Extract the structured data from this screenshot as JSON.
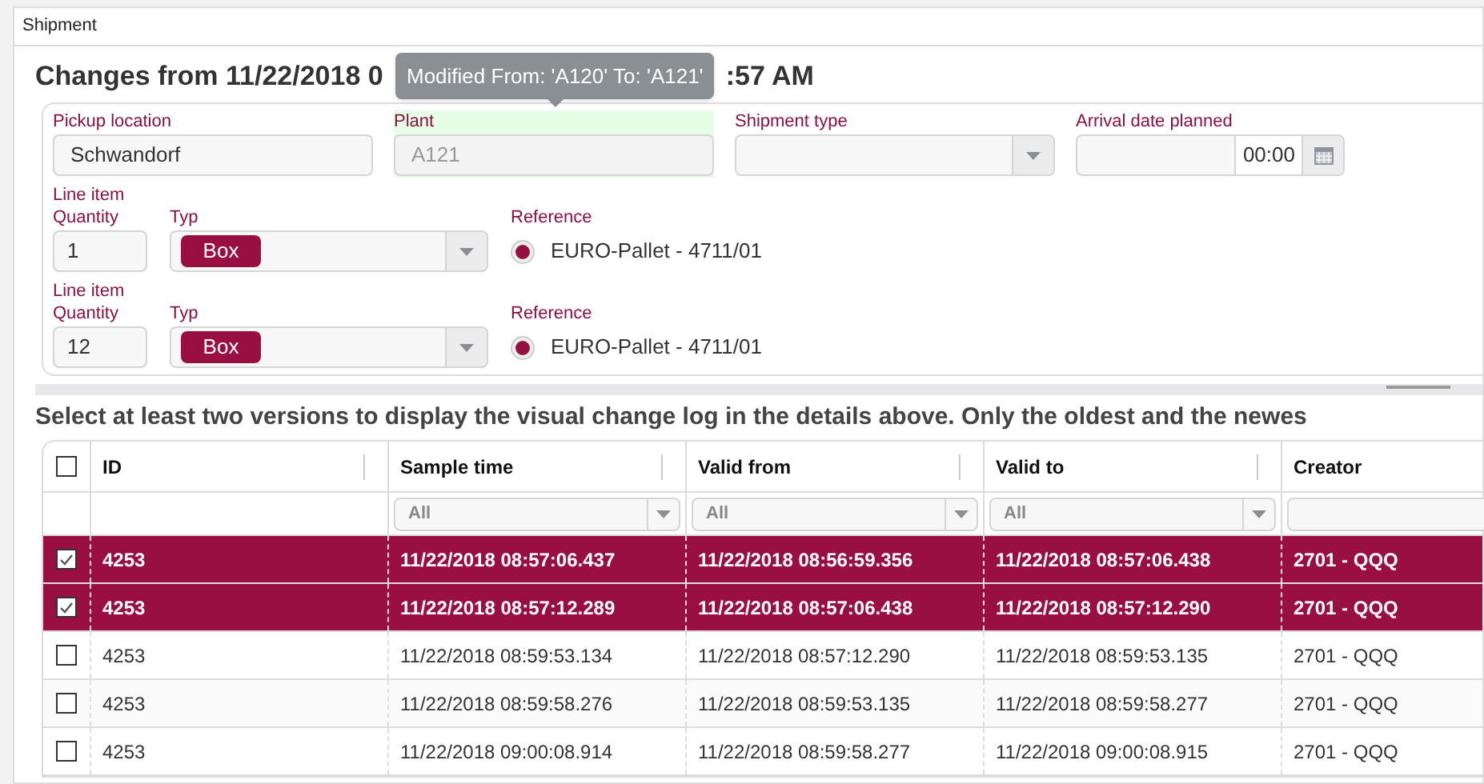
{
  "window": {
    "title": "Shipment"
  },
  "heading": {
    "start": "Changes from 11/22/2018 0",
    "end": ":57 AM"
  },
  "tooltip": {
    "text": "Modified From: 'A120' To: 'A121'"
  },
  "fields": [
    {
      "label": "Pickup location",
      "kind": "text",
      "value": "Schwandorf",
      "changed": false
    },
    {
      "label": "Plant",
      "kind": "readonly",
      "value": "A121",
      "changed": true
    },
    {
      "label": "Shipment type",
      "kind": "select",
      "changed": false
    },
    {
      "label": "Arrival date planned",
      "kind": "datetime",
      "time": "00:00",
      "changed": false
    }
  ],
  "line_items": [
    {
      "label_top": "Line item",
      "quantity_label": "Quantity",
      "quantity": "1",
      "type_label": "Typ",
      "type": "Box",
      "reference_label": "Reference",
      "reference": "EURO-Pallet - 4711/01",
      "reference_selected": true
    },
    {
      "label_top": "Line item",
      "quantity_label": "Quantity",
      "quantity": "12",
      "type_label": "Typ",
      "type": "Box",
      "reference_label": "Reference",
      "reference": "EURO-Pallet - 4711/01",
      "reference_selected": true
    }
  ],
  "instruction": "Select at least two versions to display the visual change log in the details above. Only the oldest and the newes",
  "table": {
    "all_checked": false,
    "columns": [
      {
        "label": "ID",
        "kind": "plain"
      },
      {
        "label": "Sample time",
        "kind": "select",
        "filter": "All"
      },
      {
        "label": "Valid from",
        "kind": "select",
        "filter": "All"
      },
      {
        "label": "Valid to",
        "kind": "select",
        "filter": "All"
      },
      {
        "label": "Creator",
        "kind": "text"
      }
    ],
    "rows": [
      {
        "selected": true,
        "cells": [
          "4253",
          "11/22/2018 08:57:06.437",
          "11/22/2018 08:56:59.356",
          "11/22/2018 08:57:06.438",
          "2701 - QQQ"
        ]
      },
      {
        "selected": true,
        "cells": [
          "4253",
          "11/22/2018 08:57:12.289",
          "11/22/2018 08:57:06.438",
          "11/22/2018 08:57:12.290",
          "2701 - QQQ"
        ]
      },
      {
        "selected": false,
        "cells": [
          "4253",
          "11/22/2018 08:59:53.134",
          "11/22/2018 08:57:12.290",
          "11/22/2018 08:59:53.135",
          "2701 - QQQ"
        ]
      },
      {
        "selected": false,
        "cells": [
          "4253",
          "11/22/2018 08:59:58.276",
          "11/22/2018 08:59:53.135",
          "11/22/2018 08:59:58.277",
          "2701 - QQQ"
        ]
      },
      {
        "selected": false,
        "cells": [
          "4253",
          "11/22/2018 09:00:08.914",
          "11/22/2018 08:59:58.277",
          "11/22/2018 09:00:08.915",
          "2701 - QQQ"
        ]
      }
    ]
  }
}
